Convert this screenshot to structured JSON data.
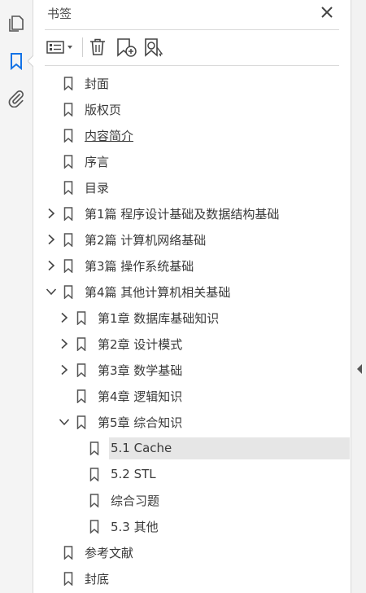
{
  "panel": {
    "title": "书签"
  },
  "tree": [
    {
      "label": "封面",
      "level": 0,
      "expander": "none"
    },
    {
      "label": "版权页",
      "level": 0,
      "expander": "none"
    },
    {
      "label": "内容简介",
      "level": 0,
      "expander": "none",
      "underlined": true
    },
    {
      "label": "序言",
      "level": 0,
      "expander": "none"
    },
    {
      "label": "目录",
      "level": 0,
      "expander": "none"
    },
    {
      "label": "第1篇 程序设计基础及数据结构基础",
      "level": 0,
      "expander": "collapsed"
    },
    {
      "label": "第2篇 计算机网络基础",
      "level": 0,
      "expander": "collapsed"
    },
    {
      "label": "第3篇 操作系统基础",
      "level": 0,
      "expander": "collapsed"
    },
    {
      "label": "第4篇 其他计算机相关基础",
      "level": 0,
      "expander": "expanded"
    },
    {
      "label": "第1章 数据库基础知识",
      "level": 1,
      "expander": "collapsed"
    },
    {
      "label": "第2章 设计模式",
      "level": 1,
      "expander": "collapsed"
    },
    {
      "label": "第3章 数学基础",
      "level": 1,
      "expander": "collapsed"
    },
    {
      "label": "第4章 逻辑知识",
      "level": 1,
      "expander": "none"
    },
    {
      "label": "第5章 综合知识",
      "level": 1,
      "expander": "expanded"
    },
    {
      "label": "5.1 Cache",
      "level": 2,
      "expander": "none",
      "selected": true
    },
    {
      "label": "5.2 STL",
      "level": 2,
      "expander": "none"
    },
    {
      "label": "综合习题",
      "level": 2,
      "expander": "none"
    },
    {
      "label": "5.3 其他",
      "level": 2,
      "expander": "none"
    },
    {
      "label": "参考文献",
      "level": 0,
      "expander": "none"
    },
    {
      "label": "封底",
      "level": 0,
      "expander": "none"
    }
  ]
}
